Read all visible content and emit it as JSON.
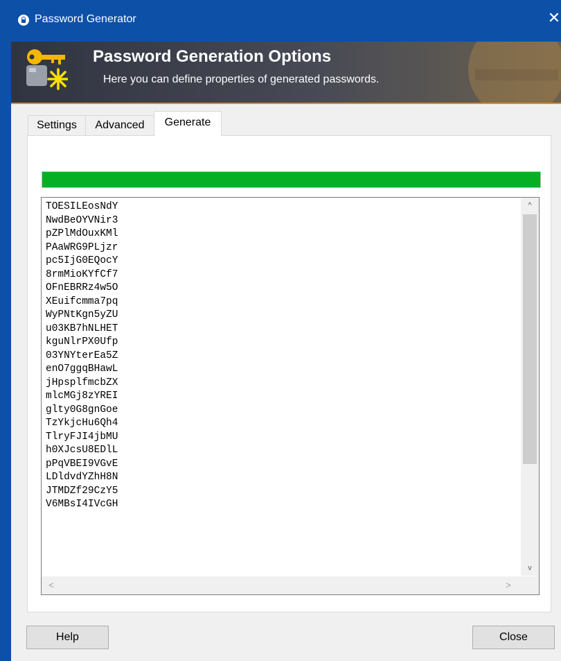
{
  "window": {
    "title": "Password Generator",
    "close_glyph": "✕"
  },
  "banner": {
    "title": "Password Generation Options",
    "subtitle": "Here you can define properties of generated passwords."
  },
  "tabs": [
    {
      "label": "Settings",
      "active": false
    },
    {
      "label": "Advanced",
      "active": false
    },
    {
      "label": "Generate",
      "active": true
    }
  ],
  "progress": {
    "value": 1.0,
    "color": "#06b025"
  },
  "passwords": [
    "TOESILEosNdY",
    "NwdBeOYVNir3",
    "pZPlMdOuxKMl",
    "PAaWRG9PLjzr",
    "pc5IjG0EQocY",
    "8rmMioKYfCf7",
    "OFnEBRRz4w5O",
    "XEuifcmma7pq",
    "WyPNtKgn5yZU",
    "u03KB7hNLHET",
    "kguNlrPX0Ufp",
    "03YNYterEa5Z",
    "enO7ggqBHawL",
    "jHpsplfmcbZX",
    "mlcMGj8zYREI",
    "glty0G8gnGoe",
    "TzYkjcHu6Qh4",
    "TlryFJI4jbMU",
    "h0XJcsU8EDlL",
    "pPqVBEI9VGvE",
    "LDldvdYZhH8N",
    "JTMDZf29CzY5",
    "V6MBsI4IVcGH"
  ],
  "buttons": {
    "help": "Help",
    "close": "Close"
  },
  "colors": {
    "titlebar": "#0c50a8",
    "accent": "#e08a1c"
  }
}
